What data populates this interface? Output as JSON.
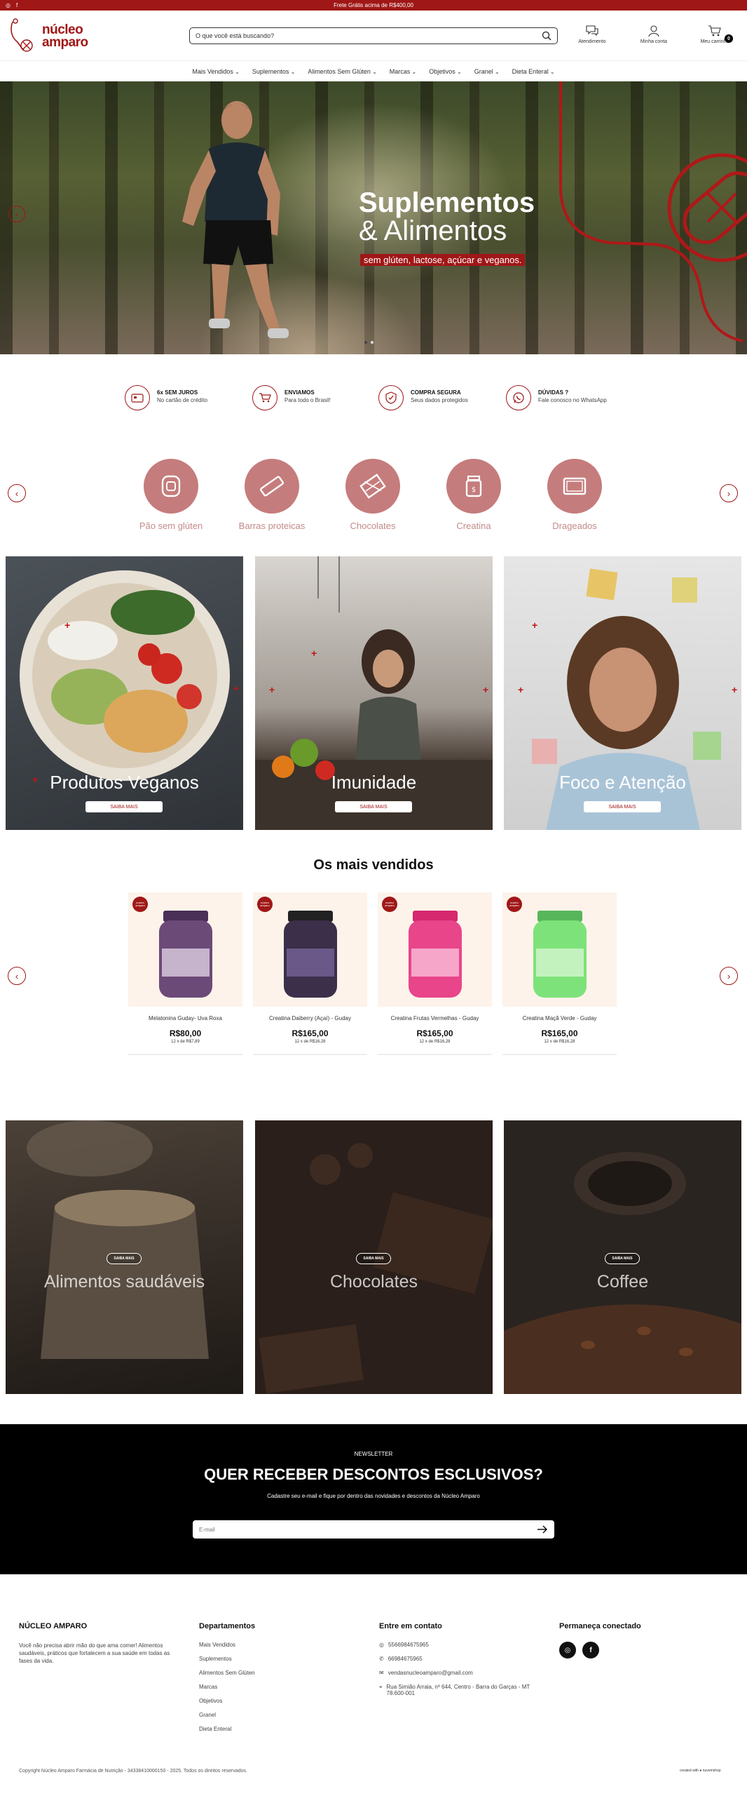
{
  "topbar": {
    "message": "Frete Grátis acima de R$400,00",
    "social_icons": [
      "instagram-icon",
      "facebook-icon"
    ]
  },
  "header": {
    "logo_line1": "núcleo",
    "logo_line2": "amparo",
    "search_placeholder": "O que você está buscando?",
    "service_label": "Atendimento",
    "account_label": "Minha conta",
    "cart_label": "Meu carrinho",
    "cart_count": "0"
  },
  "nav": [
    "Mais Vendidos",
    "Suplementos",
    "Alimentos Sem Glúten",
    "Marcas",
    "Objetivos",
    "Granel",
    "Dieta Enteral"
  ],
  "hero": {
    "title_bold": "Suplementos",
    "title_light": "& Alimentos",
    "tagline": "sem glúten, lactose, açúcar e veganos.",
    "slide_count": 2,
    "active_slide": 2
  },
  "benefits": [
    {
      "icon": "card-icon",
      "title": "6x SEM JUROS",
      "text": "No cartão de crédito"
    },
    {
      "icon": "cart-truck-icon",
      "title": "ENVIAMOS",
      "text": "Para todo o Brasil!"
    },
    {
      "icon": "shield-check-icon",
      "title": "COMPRA SEGURA",
      "text": "Seus dados protegidos"
    },
    {
      "icon": "whatsapp-icon",
      "title": "DÚVIDAS ?",
      "text": "Fale conosco no WhatsApp"
    }
  ],
  "categories": [
    "Pão sem glúten",
    "Barras proteicas",
    "Chocolates",
    "Creatina",
    "Drageados"
  ],
  "promos": [
    {
      "title": "Produtos Veganos",
      "button": "SAIBA MAIS"
    },
    {
      "title": "Imunidade",
      "button": "SAIBA MAIS"
    },
    {
      "title": "Foco e Atenção",
      "button": "SAIBA MAIS"
    }
  ],
  "bestsellers": {
    "title": "Os mais vendidos",
    "badge": "núcleo amparo",
    "products": [
      {
        "name": "Melatonina Guday- Uva Roxa",
        "price": "R$80,00",
        "installments": "12 x de R$7,89",
        "color": "#6c4a78"
      },
      {
        "name": "Creatina Daiberry (Açaí) - Guday",
        "price": "R$165,00",
        "installments": "12 x de R$16,28",
        "color": "#3b2f4a"
      },
      {
        "name": "Creatina Frutas Vermelhas - Guday",
        "price": "R$165,00",
        "installments": "12 x de R$16,28",
        "color": "#e8458a"
      },
      {
        "name": "Creatina Maçã Verde - Guday",
        "price": "R$165,00",
        "installments": "12 x de R$16,28",
        "color": "#7ee27a"
      }
    ]
  },
  "tiles": [
    {
      "title": "Alimentos saudáveis",
      "button": "SAIBA MAIS"
    },
    {
      "title": "Chocolates",
      "button": "SAIBA MAIS"
    },
    {
      "title": "Coffee",
      "button": "SAIBA MAIS"
    }
  ],
  "newsletter": {
    "kicker": "NEWSLETTER",
    "title": "QUER RECEBER DESCONTOS ESCLUSIVOS?",
    "description": "Cadastre seu e-mail e fique por dentro das novidades e descontos da Núcleo Amparo",
    "email_placeholder": "E-mail"
  },
  "footer": {
    "about_title": "NÚCLEO AMPARO",
    "about_text": "Você não precisa abrir mão do que ama comer! Alimentos saudáveis, práticos que fortalecem a sua saúde em todas as fases da vida.",
    "departments_title": "Departamentos",
    "departments": [
      "Mais Vendidos",
      "Suplementos",
      "Alimentos Sem Glúten",
      "Marcas",
      "Objetivos",
      "Granel",
      "Dieta Enteral"
    ],
    "contact_title": "Entre em contato",
    "contact": {
      "whatsapp": "5566984675965",
      "phone": "66984675965",
      "email": "vendasnucleoamparo@gmail.com",
      "address": "Rua Simião Arraia, nº 644, Centro - Barra do Garças - MT 78.600-001"
    },
    "social_title": "Permaneça conectado",
    "social_icons": [
      "instagram-icon",
      "facebook-icon"
    ],
    "copyright": "Copyright Núcleo Amparo Farmácia de Nutrição - 34338410000150 - 2025. Todos os direitos reservados.",
    "credit": "created with ● nuvemshop"
  },
  "colors": {
    "brand": "#a01717",
    "category": "#c57c7c",
    "newsletter_bg": "#000000"
  }
}
